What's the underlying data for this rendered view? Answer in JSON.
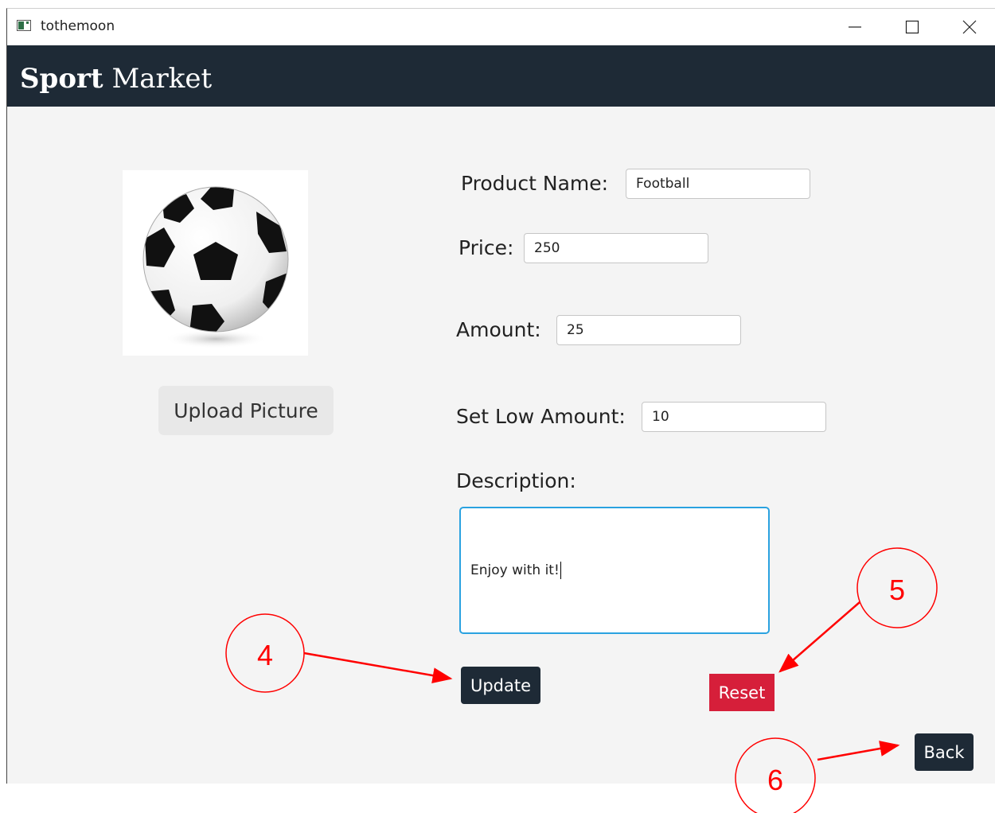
{
  "window": {
    "title": "tothemoon",
    "icons": {
      "minimize": "minimize-icon",
      "maximize": "maximize-icon",
      "close": "close-icon",
      "app": "app-icon"
    }
  },
  "header": {
    "brand_bold": "Sport",
    "brand_regular": "Market",
    "background": "#1e2a36"
  },
  "product": {
    "image": "soccer-ball-image",
    "upload_label": "Upload Picture"
  },
  "form": {
    "name_label": "Product Name:",
    "name_value": "Football",
    "price_label": "Price:",
    "price_value": "250",
    "amount_label": "Amount:",
    "amount_value": "25",
    "low_label": "Set Low Amount:",
    "low_value": "10",
    "description_label": "Description:",
    "description_value": "Enjoy with it!"
  },
  "actions": {
    "update_label": "Update",
    "reset_label": "Reset",
    "back_label": "Back",
    "reset_color": "#d61f3a",
    "dark_color": "#1e2a36"
  },
  "annotations": {
    "four": "4",
    "five": "5",
    "six": "6",
    "color": "#ff0000"
  }
}
